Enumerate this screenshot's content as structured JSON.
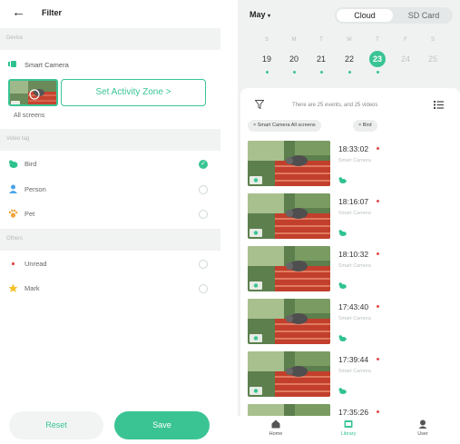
{
  "filter": {
    "title": "Filter",
    "back_icon": "arrow-left-icon",
    "sections": {
      "device": "Device",
      "video_tag": "Video tag",
      "others": "Others"
    },
    "device": {
      "camera_name": "Smart Camera",
      "set_zone_label": "Set Activity Zone >",
      "all_screens": "All screens"
    },
    "video_tags": [
      {
        "label": "Bird",
        "icon": "bird-icon",
        "selected": true
      },
      {
        "label": "Person",
        "icon": "person-icon",
        "selected": false
      },
      {
        "label": "Pet",
        "icon": "paw-icon",
        "selected": false
      }
    ],
    "others": [
      {
        "label": "Unread",
        "icon": "red-dot-icon",
        "selected": false
      },
      {
        "label": "Mark",
        "icon": "star-icon",
        "selected": false
      }
    ],
    "reset_label": "Reset",
    "save_label": "Save",
    "accent": "#3ac494"
  },
  "library": {
    "month": "May",
    "storage_tabs": {
      "cloud": "Cloud",
      "sd": "SD Card",
      "active": "cloud"
    },
    "weekdays": [
      "S",
      "M",
      "T",
      "W",
      "T",
      "F",
      "S"
    ],
    "dates": [
      "19",
      "20",
      "21",
      "22",
      "23",
      "24",
      "25"
    ],
    "selected_date": "23",
    "summary": "There are 25 events, and 25 videos",
    "chips": [
      "Smart Camera All screens",
      "Bird"
    ],
    "events": [
      {
        "time": "18:33:02",
        "camera": "Smart Camera"
      },
      {
        "time": "18:16:07",
        "camera": "Smart Camera"
      },
      {
        "time": "18:10:32",
        "camera": "Smart Camera"
      },
      {
        "time": "17:43:40",
        "camera": "Smart Camera"
      },
      {
        "time": "17:39:44",
        "camera": "Smart Camera"
      },
      {
        "time": "17:35:26",
        "camera": ""
      }
    ],
    "tabs": [
      {
        "label": "Home",
        "icon": "home-icon"
      },
      {
        "label": "Library",
        "icon": "library-icon",
        "active": true
      },
      {
        "label": "User",
        "icon": "user-icon"
      }
    ]
  }
}
